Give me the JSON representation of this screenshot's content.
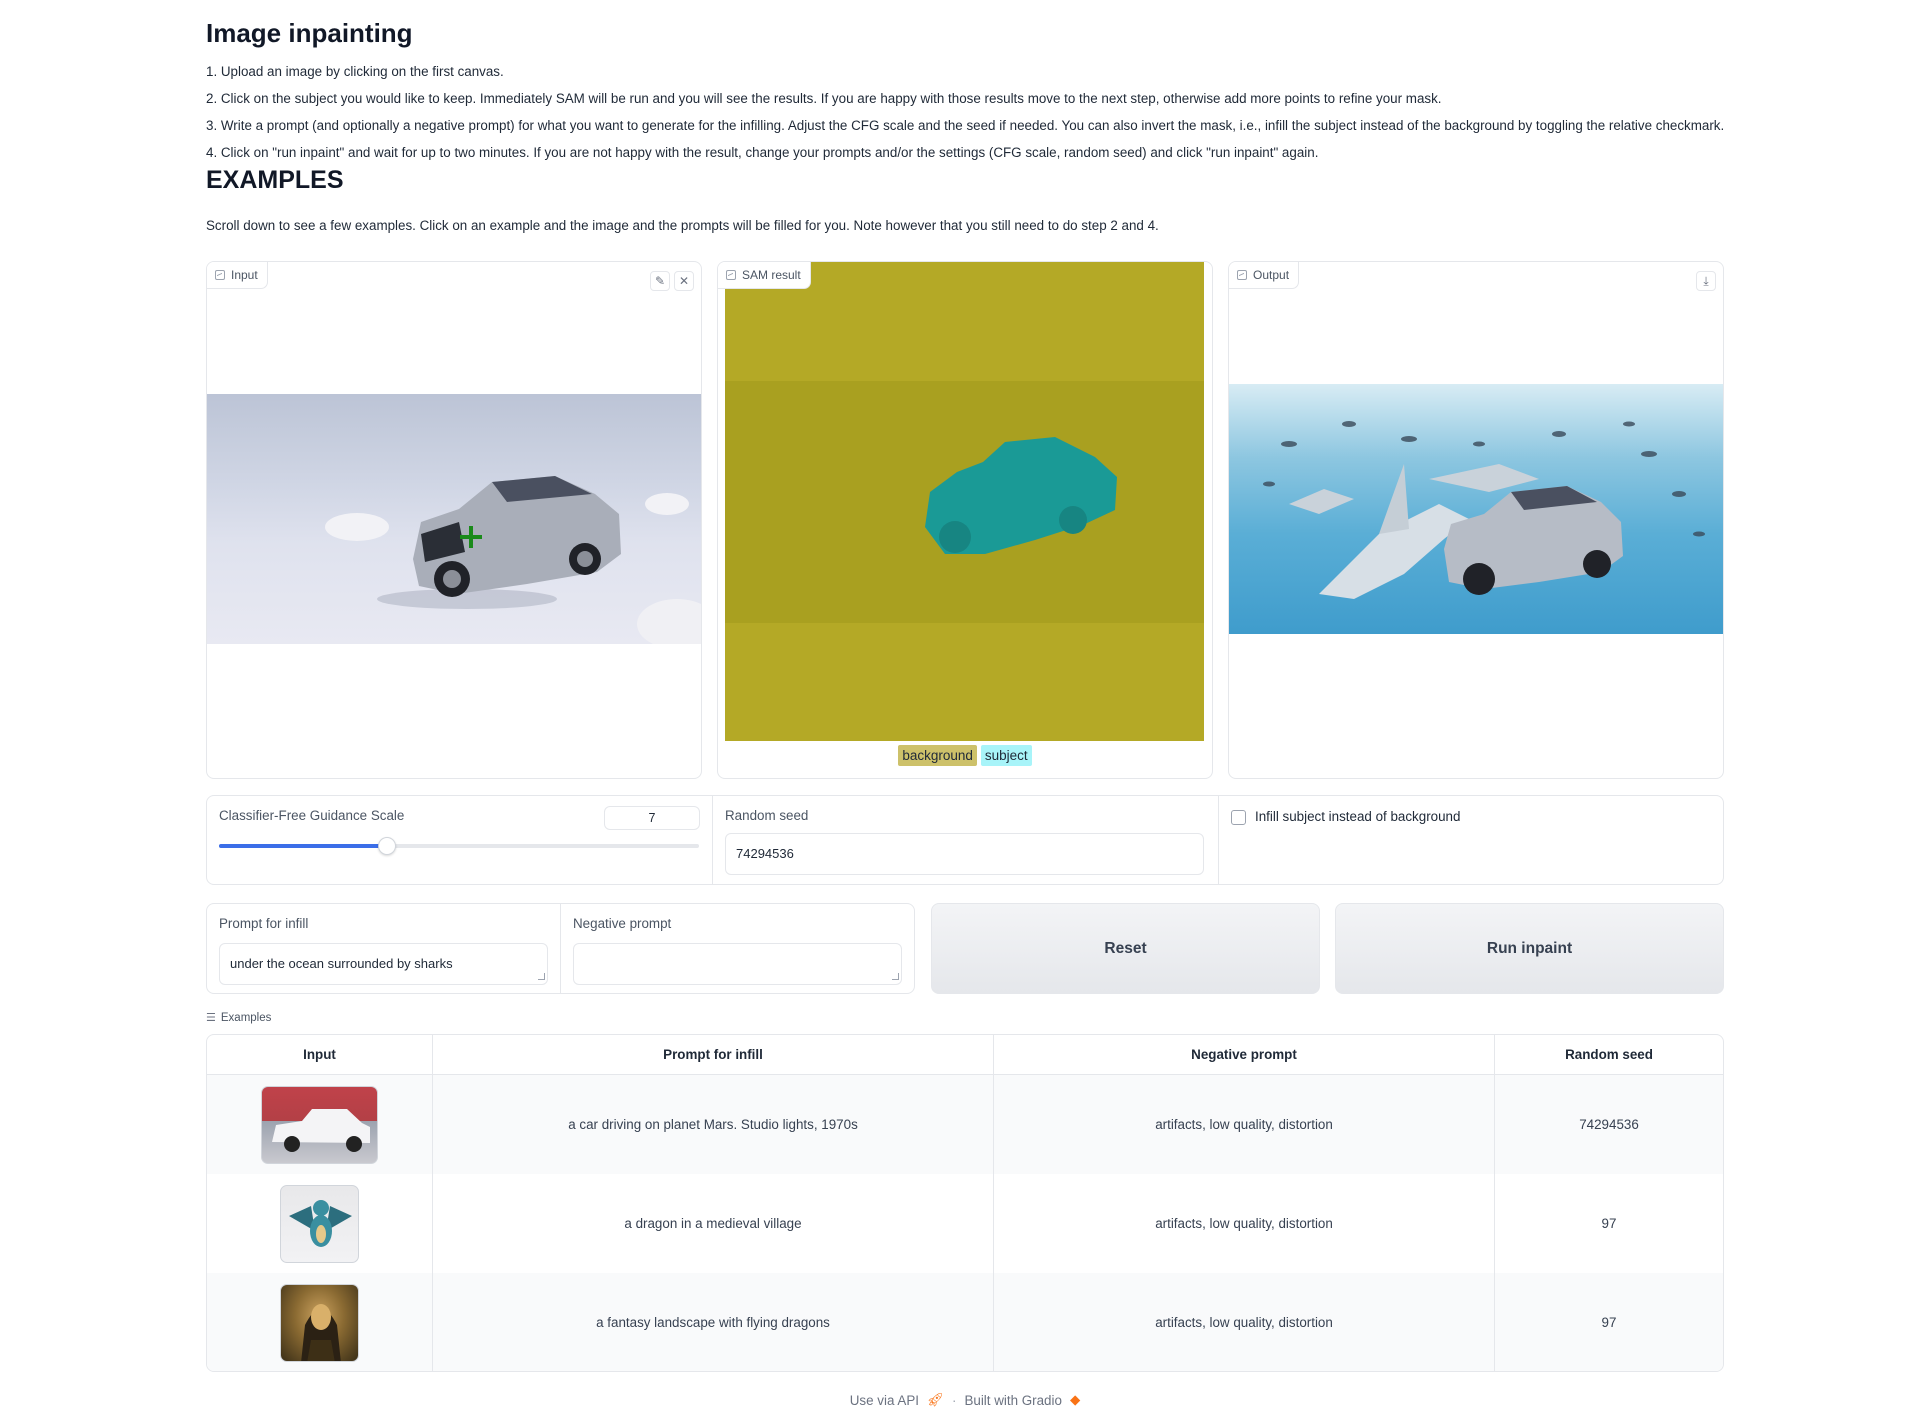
{
  "header": {
    "title": "Image inpainting",
    "steps": [
      "1. Upload an image by clicking on the first canvas.",
      "2. Click on the subject you would like to keep. Immediately SAM will be run and you will see the results. If you are happy with those results move to the next step, otherwise add more points to refine your mask.",
      "3. Write a prompt (and optionally a negative prompt) for what you want to generate for the infilling. Adjust the CFG scale and the seed if needed. You can also invert the mask, i.e., infill the subject instead of the background by toggling the relative checkmark.",
      "4. Click on \"run inpaint\" and wait for up to two minutes. If you are not happy with the result, change your prompts and/or the settings (CFG scale, random seed) and click \"run inpaint\" again."
    ],
    "examples_title": "EXAMPLES",
    "examples_intro": "Scroll down to see a few examples. Click on an example and the image and the prompts will be filled for you. Note however that you still need to do step 2 and 4."
  },
  "panels": {
    "input_label": "Input",
    "sam_label": "SAM result",
    "output_label": "Output",
    "legend_background": "background",
    "legend_subject": "subject"
  },
  "settings": {
    "cfg_label": "Classifier-Free Guidance Scale",
    "cfg_value": "7",
    "cfg_fraction": 0.35,
    "seed_label": "Random seed",
    "seed_value": "74294536",
    "checkbox_label": "Infill subject instead of background",
    "checkbox_checked": false
  },
  "prompts": {
    "prompt_label": "Prompt for infill",
    "prompt_value": "under the ocean surrounded by sharks",
    "negative_label": "Negative prompt",
    "negative_value": ""
  },
  "buttons": {
    "reset": "Reset",
    "run": "Run inpaint"
  },
  "examples": {
    "heading": "Examples",
    "columns": [
      "Input",
      "Prompt for infill",
      "Negative prompt",
      "Random seed"
    ],
    "rows": [
      {
        "prompt": "a car driving on planet Mars. Studio lights, 1970s",
        "negative": "artifacts, low quality, distortion",
        "seed": "74294536"
      },
      {
        "prompt": "a dragon in a medieval village",
        "negative": "artifacts, low quality, distortion",
        "seed": "97"
      },
      {
        "prompt": "a fantasy landscape with flying dragons",
        "negative": "artifacts, low quality, distortion",
        "seed": "97"
      }
    ]
  },
  "footer": {
    "api": "Use via API",
    "built": "Built with Gradio"
  },
  "colors": {
    "sam_background": "#b4a926",
    "sam_subject": "#1a9a96",
    "slider_accent": "#3b6ee8"
  }
}
